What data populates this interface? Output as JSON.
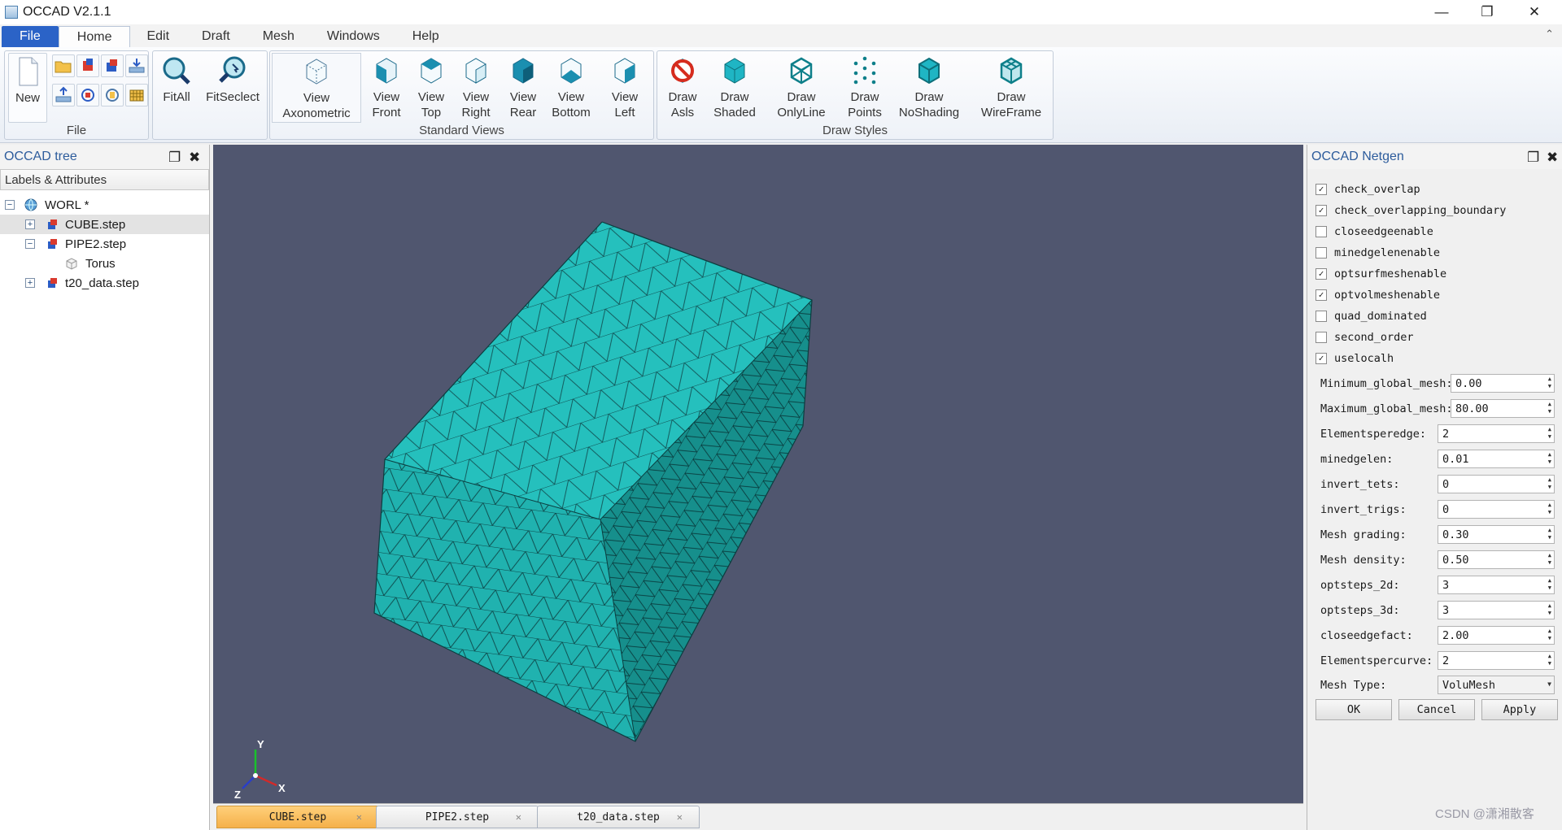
{
  "window": {
    "title": "OCCAD V2.1.1"
  },
  "menu": {
    "file": "File",
    "tabs": [
      "Home",
      "Edit",
      "Draft",
      "Mesh",
      "Windows",
      "Help"
    ]
  },
  "ribbon": {
    "file_group": {
      "label": "File",
      "new": "New"
    },
    "fit": {
      "fitall": "FitAll",
      "fitselect": "FitSeclect"
    },
    "views_group": {
      "label": "Standard Views",
      "items": [
        {
          "l1": "View",
          "l2": "Axonometric"
        },
        {
          "l1": "View",
          "l2": "Front"
        },
        {
          "l1": "View",
          "l2": "Top"
        },
        {
          "l1": "View",
          "l2": "Right"
        },
        {
          "l1": "View",
          "l2": "Rear"
        },
        {
          "l1": "View",
          "l2": "Bottom"
        },
        {
          "l1": "View",
          "l2": "Left"
        }
      ]
    },
    "draw_group": {
      "label": "Draw Styles",
      "items": [
        {
          "l1": "Draw",
          "l2": "Asls"
        },
        {
          "l1": "Draw",
          "l2": "Shaded"
        },
        {
          "l1": "Draw",
          "l2": "OnlyLine"
        },
        {
          "l1": "Draw",
          "l2": "Points"
        },
        {
          "l1": "Draw",
          "l2": "NoShading"
        },
        {
          "l1": "Draw",
          "l2": "WireFrame"
        }
      ]
    }
  },
  "tree": {
    "title": "OCCAD tree",
    "header": "Labels & Attributes",
    "items": [
      "WORL *",
      "CUBE.step",
      "PIPE2.step",
      "Torus",
      "t20_data.step"
    ]
  },
  "doc_tabs": [
    "CUBE.step",
    "PIPE2.step",
    "t20_data.step"
  ],
  "axis": {
    "x": "X",
    "y": "Y",
    "z": "Z"
  },
  "netgen": {
    "title": "OCCAD Netgen",
    "checks": [
      {
        "label": "check_overlap",
        "checked": true
      },
      {
        "label": "check_overlapping_boundary",
        "checked": true
      },
      {
        "label": "closeedgeenable",
        "checked": false
      },
      {
        "label": "minedgelenenable",
        "checked": false
      },
      {
        "label": "optsurfmeshenable",
        "checked": true
      },
      {
        "label": "optvolmeshenable",
        "checked": true
      },
      {
        "label": "quad_dominated",
        "checked": false
      },
      {
        "label": "second_order",
        "checked": false
      },
      {
        "label": "uselocalh",
        "checked": true
      }
    ],
    "params": [
      {
        "label": "Minimum_global_mesh:",
        "value": "0.00"
      },
      {
        "label": "Maximum_global_mesh:",
        "value": "80.00"
      },
      {
        "label": "Elementsperedge:",
        "value": "2"
      },
      {
        "label": "minedgelen:",
        "value": "0.01"
      },
      {
        "label": "invert_tets:",
        "value": "0"
      },
      {
        "label": "invert_trigs:",
        "value": "0"
      },
      {
        "label": "Mesh grading:",
        "value": "0.30"
      },
      {
        "label": "Mesh density:",
        "value": "0.50"
      },
      {
        "label": "optsteps_2d:",
        "value": "3"
      },
      {
        "label": "optsteps_3d:",
        "value": "3"
      },
      {
        "label": "closeedgefact:",
        "value": "2.00"
      },
      {
        "label": "Elementspercurve:",
        "value": "2"
      }
    ],
    "mesh_type_label": "Mesh Type:",
    "mesh_type_value": "VoluMesh",
    "ok": "OK",
    "cancel": "Cancel",
    "apply": "Apply"
  },
  "watermark": "CSDN @潇湘散客",
  "colors": {
    "accent": "#2b63c7",
    "mesh": "#1fb5b5",
    "viewport_bg": "#50566f",
    "active_tab": "#f5b04a"
  }
}
